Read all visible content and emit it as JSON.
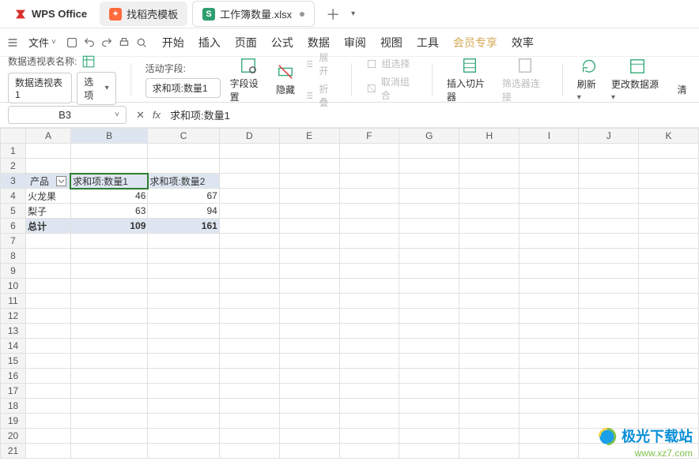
{
  "app": {
    "name": "WPS Office"
  },
  "tabs": {
    "template": "找稻壳模板",
    "workbook": "工作簿数量.xlsx"
  },
  "menubar": {
    "file": "文件",
    "items": [
      "开始",
      "插入",
      "页面",
      "公式",
      "数据",
      "审阅",
      "视图",
      "工具",
      "会员专享",
      "效率"
    ]
  },
  "ribbon": {
    "pivot_name_label": "数据透视表名称:",
    "pivot_name_value": "数据透视表1",
    "options": "选项",
    "active_field_label": "活动字段:",
    "active_field_value": "求和项:数量1",
    "field_settings": "字段设置",
    "hide": "隐藏",
    "expand": "展开",
    "collapse": "折叠",
    "group_sel": "组选择",
    "ungroup": "取消组合",
    "insert_slicer": "插入切片器",
    "filter_conn": "筛选器连接",
    "refresh": "刷新",
    "change_source": "更改数据源",
    "clear": "清"
  },
  "formula": {
    "namebox": "B3",
    "content": "求和项:数量1"
  },
  "columns": [
    "A",
    "B",
    "C",
    "D",
    "E",
    "F",
    "G",
    "H",
    "I",
    "J",
    "K"
  ],
  "selected_col": "B",
  "selected_row": 3,
  "pivot": {
    "header_product": "产品",
    "header_sum1": "求和项:数量1",
    "header_sum2": "求和项:数量2",
    "rows": [
      {
        "label": "火龙果",
        "v1": "46",
        "v2": "67"
      },
      {
        "label": "梨子",
        "v1": "63",
        "v2": "94"
      }
    ],
    "total_label": "总计",
    "total_v1": "109",
    "total_v2": "161"
  },
  "watermark": {
    "title": "极光下载站",
    "url": "www.xz7.com"
  },
  "chart_data": {
    "type": "table",
    "title": "数据透视表",
    "columns": [
      "产品",
      "求和项:数量1",
      "求和项:数量2"
    ],
    "rows": [
      [
        "火龙果",
        46,
        67
      ],
      [
        "梨子",
        63,
        94
      ],
      [
        "总计",
        109,
        161
      ]
    ]
  }
}
